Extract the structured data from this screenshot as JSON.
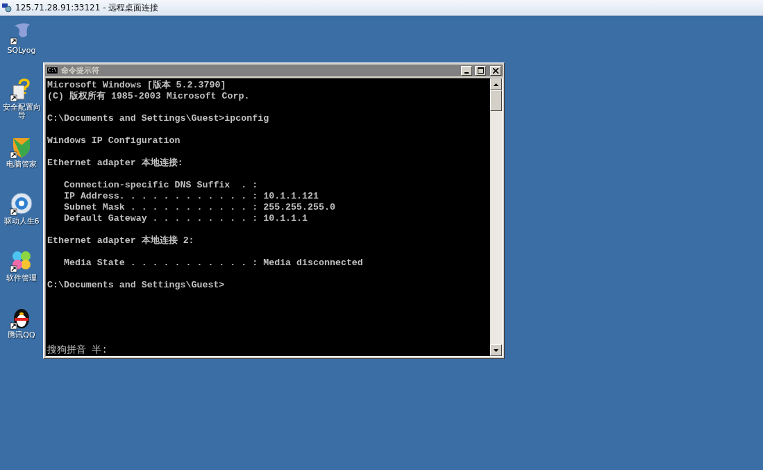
{
  "window": {
    "title": "125.71.28.91:33121 - 远程桌面连接"
  },
  "desktop_icons": [
    {
      "label": "SQLyog",
      "kind": "dolphin"
    },
    {
      "label": "安全配置向导",
      "kind": "question"
    },
    {
      "label": "电脑管家",
      "kind": "shield"
    },
    {
      "label": "驱动人生6",
      "kind": "gear"
    },
    {
      "label": "软件管理",
      "kind": "petals"
    },
    {
      "label": "腾讯QQ",
      "kind": "penguin"
    }
  ],
  "console": {
    "title": "命令提示符",
    "icon_text": "C:\\",
    "paragraphs": [
      [
        "Microsoft Windows [版本 5.2.3790]",
        "(C) 版权所有 1985-2003 Microsoft Corp."
      ],
      [
        "C:\\Documents and Settings\\Guest>ipconfig"
      ],
      [
        "Windows IP Configuration"
      ],
      [
        "Ethernet adapter 本地连接:"
      ],
      [
        "   Connection-specific DNS Suffix  . :",
        "   IP Address. . . . . . . . . . . . : 10.1.1.121",
        "   Subnet Mask . . . . . . . . . . . : 255.255.255.0",
        "   Default Gateway . . . . . . . . . : 10.1.1.1"
      ],
      [
        "Ethernet adapter 本地连接 2:"
      ],
      [
        "   Media State . . . . . . . . . . . : Media disconnected"
      ],
      [
        "C:\\Documents and Settings\\Guest>"
      ]
    ],
    "ime_status": "搜狗拼音 半:"
  }
}
